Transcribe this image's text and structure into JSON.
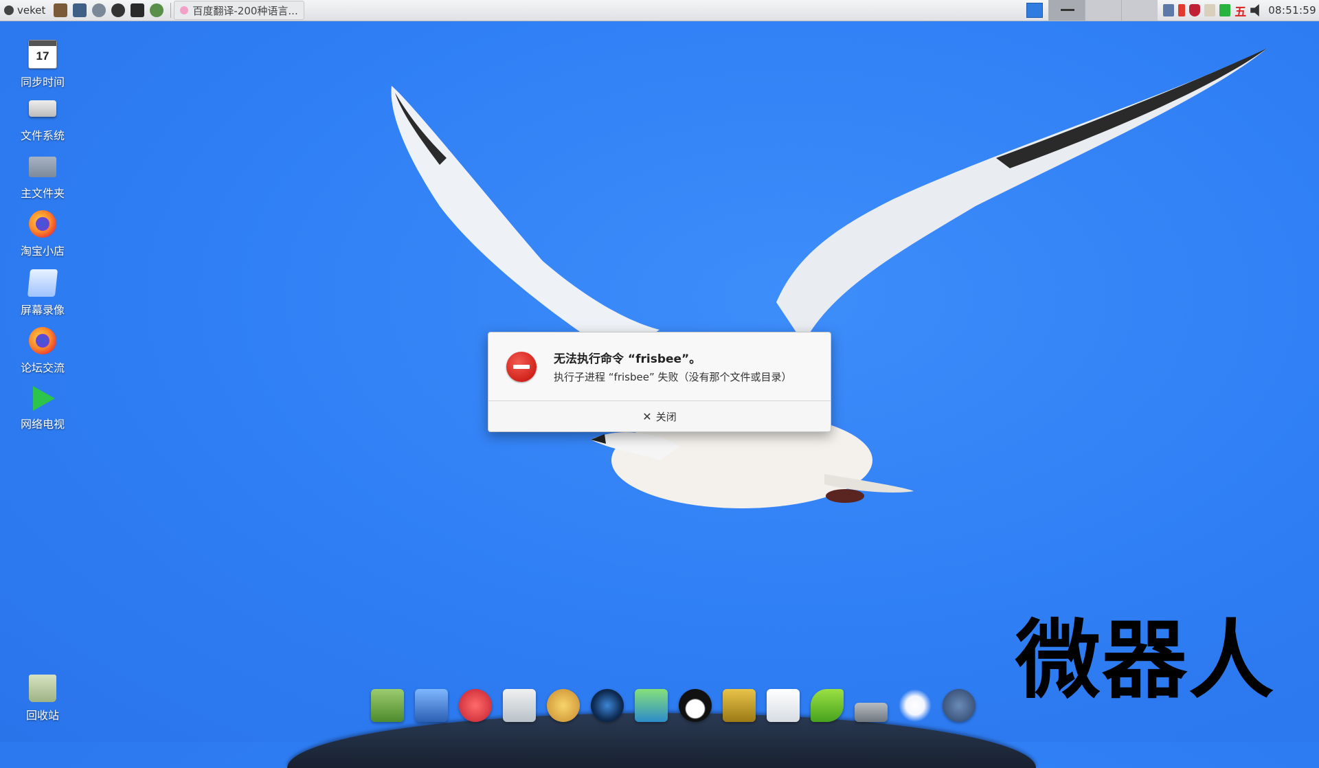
{
  "panel": {
    "menu_label": "veket",
    "launchers": [
      "paint-icon",
      "system-monitor-icon",
      "settings-icon",
      "media-player-icon",
      "terminal-icon",
      "browser-icon"
    ],
    "task_button": "百度翻译-200种语言...",
    "clock": "08:51:59",
    "ime_label": "五"
  },
  "desktop": {
    "icons": [
      {
        "label": "同步时间",
        "calendar_day": "17"
      },
      {
        "label": "文件系统"
      },
      {
        "label": "主文件夹"
      },
      {
        "label": "淘宝小店"
      },
      {
        "label": "屏幕录像"
      },
      {
        "label": "论坛交流"
      },
      {
        "label": "网络电视"
      },
      {
        "label": "回收站"
      }
    ]
  },
  "dialog": {
    "title": "无法执行命令 “frisbee”。",
    "message": "执行子进程 “frisbee” 失败（没有那个文件或目录）",
    "close_label": "关闭"
  },
  "watermark": "微器人",
  "colors": {
    "desktop_bg": "#2f7ef4",
    "error_red": "#d2231b",
    "dock_base": "#1f2b40"
  },
  "dock": {
    "items": [
      "file-manager-icon",
      "monitor-icon",
      "pet-icon",
      "editor-icon",
      "paint-palette-icon",
      "media-icon",
      "network-users-icon",
      "qq-icon",
      "book-icon",
      "chart-icon",
      "help-icon",
      "drive-icon",
      "brightness-icon",
      "globe-icon"
    ]
  }
}
